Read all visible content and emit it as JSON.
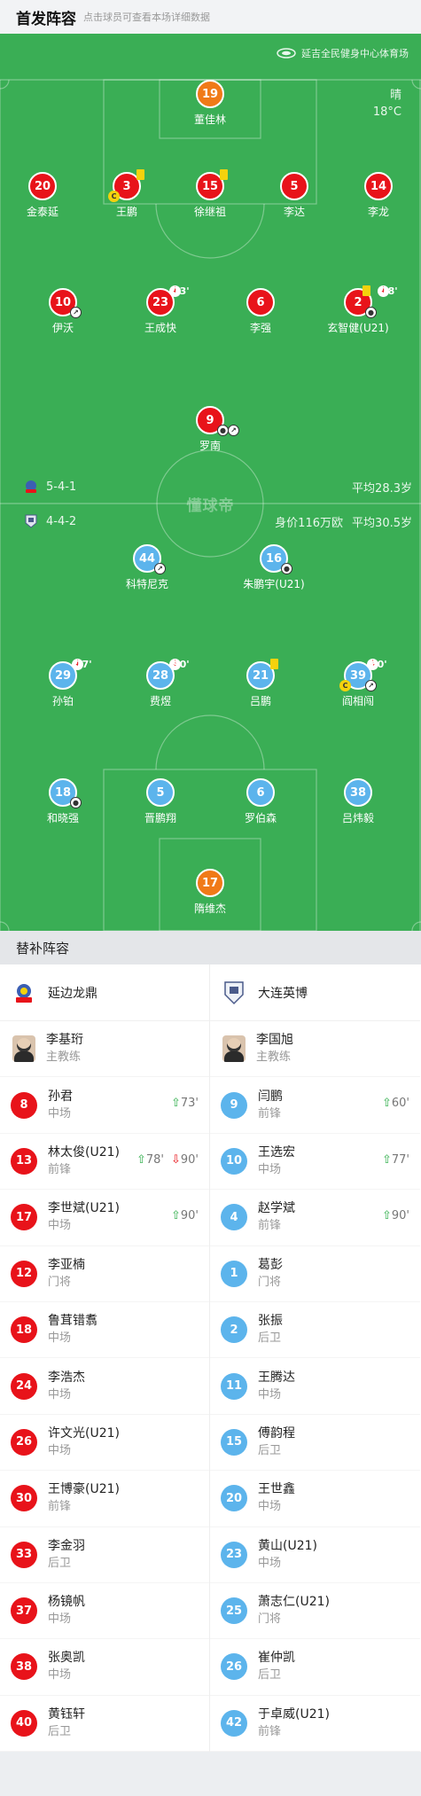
{
  "header": {
    "title": "首发阵容",
    "hint": "点击球员可查看本场详细数据"
  },
  "venue": "延吉全民健身中心体育场",
  "weather": {
    "condition": "晴",
    "temp": "18°C"
  },
  "watermark": "懂球帝",
  "home_form": {
    "formation": "5-4-1",
    "avg_age": "平均28.3岁"
  },
  "away_form": {
    "formation": "4-4-2",
    "value": "身价116万欧",
    "avg_age": "平均30.5岁"
  },
  "colors": {
    "pitch": "#3aae55",
    "home": "#e8131a",
    "away": "#5cb4ec",
    "keeper": "#f07a18"
  },
  "home_players": {
    "gk": {
      "num": "19",
      "name": "董佳林"
    },
    "d1": {
      "num": "20",
      "name": "金泰延"
    },
    "d2": {
      "num": "3",
      "name": "王鹏"
    },
    "d3": {
      "num": "15",
      "name": "徐继祖"
    },
    "d4": {
      "num": "5",
      "name": "李达"
    },
    "d5": {
      "num": "14",
      "name": "李龙"
    },
    "m1": {
      "num": "10",
      "name": "伊沃"
    },
    "m2": {
      "num": "23",
      "name": "王成快",
      "time": "73'"
    },
    "m3": {
      "num": "6",
      "name": "李强"
    },
    "m4": {
      "num": "2",
      "name": "玄智健(U21)",
      "time": "78'"
    },
    "f1": {
      "num": "9",
      "name": "罗南"
    }
  },
  "away_players": {
    "f1": {
      "num": "44",
      "name": "科特尼克"
    },
    "f2": {
      "num": "16",
      "name": "朱鹏宇(U21)"
    },
    "m1": {
      "num": "29",
      "name": "孙铂",
      "time": "77'"
    },
    "m2": {
      "num": "28",
      "name": "费煜",
      "time": "90'"
    },
    "m3": {
      "num": "21",
      "name": "吕鹏"
    },
    "m4": {
      "num": "39",
      "name": "阎相闯",
      "time": "60'"
    },
    "d1": {
      "num": "18",
      "name": "和晓强"
    },
    "d2": {
      "num": "5",
      "name": "晋鹏翔"
    },
    "d3": {
      "num": "6",
      "name": "罗伯森"
    },
    "d4": {
      "num": "38",
      "name": "吕炜毅"
    },
    "gk": {
      "num": "17",
      "name": "隋维杰"
    }
  },
  "subs": {
    "title": "替补阵容",
    "home_team": "延边龙鼎",
    "away_team": "大连英博",
    "home": [
      {
        "name": "李基珩",
        "pos": "主教练"
      },
      {
        "num": "8",
        "name": "孙君",
        "pos": "中场",
        "in": "73'"
      },
      {
        "num": "13",
        "name": "林太俊(U21)",
        "pos": "前锋",
        "in": "78'",
        "out": "90'"
      },
      {
        "num": "17",
        "name": "李世斌(U21)",
        "pos": "中场",
        "in": "90'"
      },
      {
        "num": "12",
        "name": "李亚楠",
        "pos": "门将"
      },
      {
        "num": "18",
        "name": "鲁茸错翥",
        "pos": "中场"
      },
      {
        "num": "24",
        "name": "李浩杰",
        "pos": "中场"
      },
      {
        "num": "26",
        "name": "许文光(U21)",
        "pos": "中场"
      },
      {
        "num": "30",
        "name": "王博豪(U21)",
        "pos": "前锋"
      },
      {
        "num": "33",
        "name": "李金羽",
        "pos": "后卫"
      },
      {
        "num": "37",
        "name": "杨镜帆",
        "pos": "中场"
      },
      {
        "num": "38",
        "name": "张奥凯",
        "pos": "中场"
      },
      {
        "num": "40",
        "name": "黄钰轩",
        "pos": "后卫"
      }
    ],
    "away": [
      {
        "name": "李国旭",
        "pos": "主教练"
      },
      {
        "num": "9",
        "name": "闫鹏",
        "pos": "前锋",
        "in": "60'"
      },
      {
        "num": "10",
        "name": "王选宏",
        "pos": "中场",
        "in": "77'"
      },
      {
        "num": "4",
        "name": "赵学斌",
        "pos": "前锋",
        "in": "90'"
      },
      {
        "num": "1",
        "name": "葛彭",
        "pos": "门将"
      },
      {
        "num": "2",
        "name": "张振",
        "pos": "后卫"
      },
      {
        "num": "11",
        "name": "王腾达",
        "pos": "中场"
      },
      {
        "num": "15",
        "name": "傅韵程",
        "pos": "后卫"
      },
      {
        "num": "20",
        "name": "王世鑫",
        "pos": "中场"
      },
      {
        "num": "23",
        "name": "黄山(U21)",
        "pos": "中场"
      },
      {
        "num": "25",
        "name": "萧志仁(U21)",
        "pos": "门将"
      },
      {
        "num": "26",
        "name": "崔仲凯",
        "pos": "后卫"
      },
      {
        "num": "42",
        "name": "于卓威(U21)",
        "pos": "前锋"
      }
    ]
  }
}
